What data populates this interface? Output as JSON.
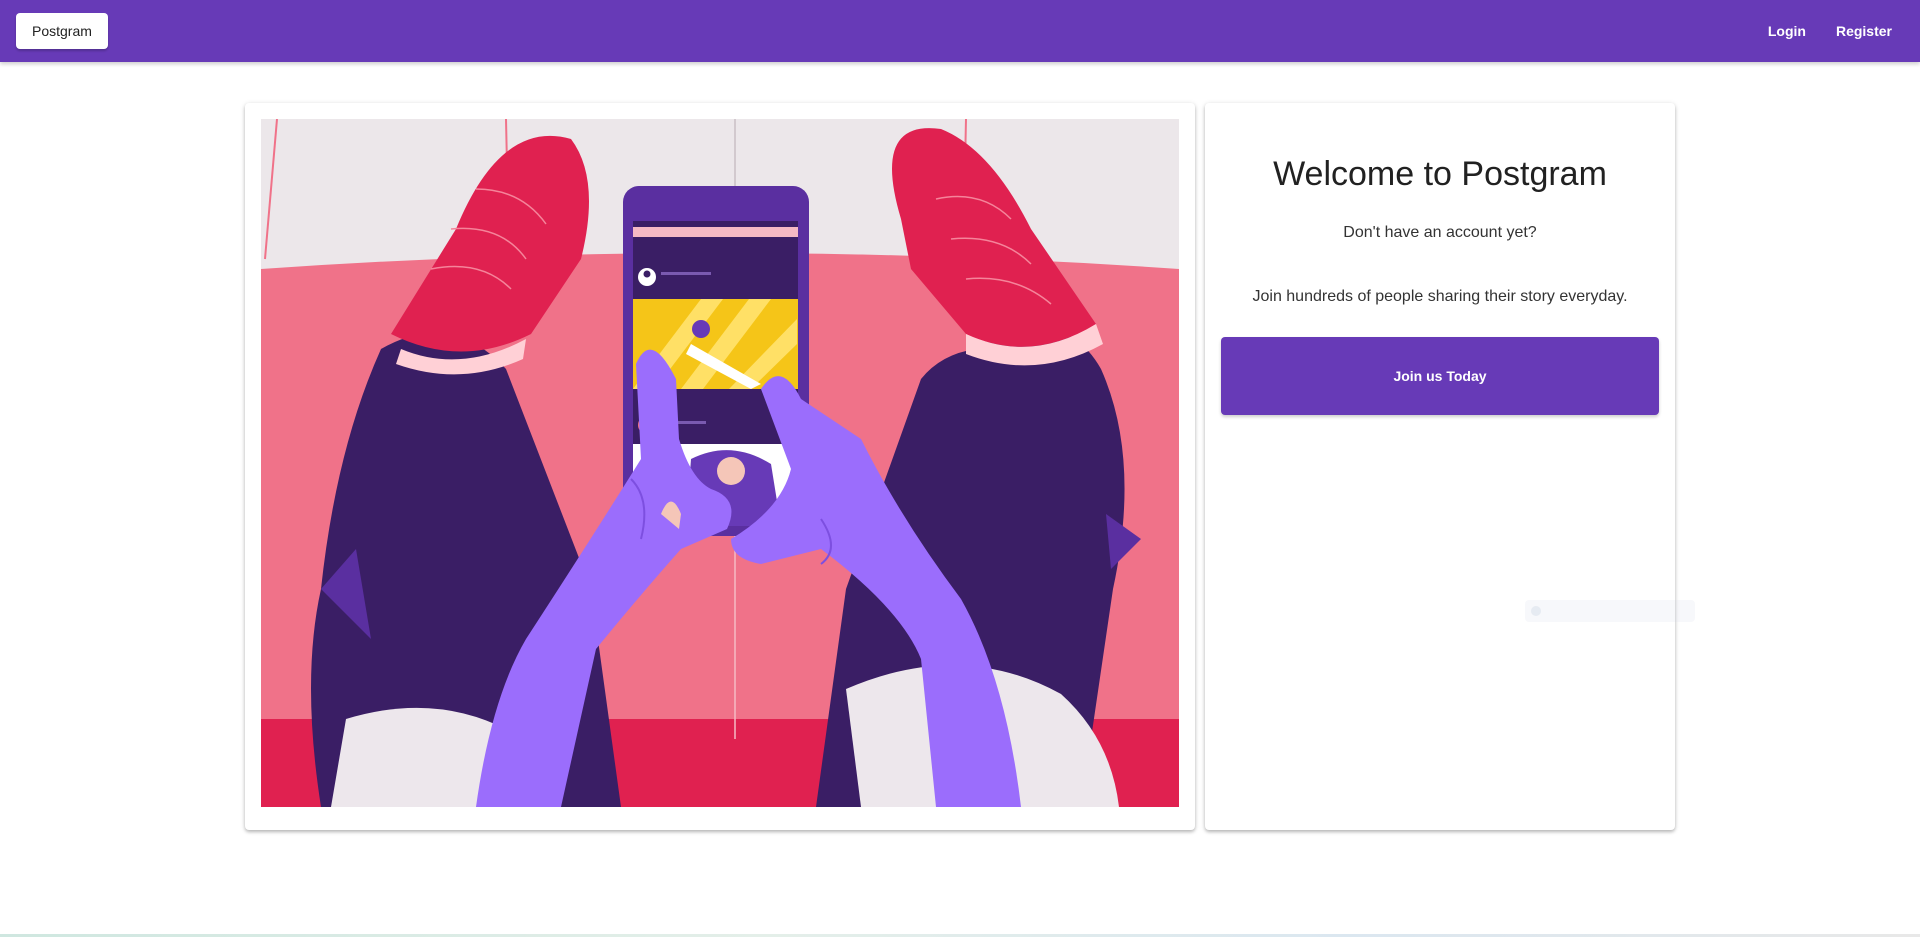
{
  "appbar": {
    "brand_label": "Postgram",
    "nav": {
      "login_label": "Login",
      "register_label": "Register"
    },
    "color": "#673ab7"
  },
  "welcome": {
    "title": "Welcome to Postgram",
    "subtitle": "Don't have an account yet?",
    "description": "Join hundreds of people sharing their story everyday.",
    "cta_label": "Join us Today"
  },
  "illustration": {
    "subject": "legs-and-hands-holding-phone-illustration",
    "icons": [
      "phone-icon",
      "avatar-icon"
    ]
  },
  "colors": {
    "primary": "#673ab7",
    "hand": "#9b6dfc",
    "pants": "#3a1e65",
    "socks": "#e02150",
    "sofa": "#f07289",
    "sneaker": "#ede7ec",
    "wall": "#ece7ea"
  }
}
